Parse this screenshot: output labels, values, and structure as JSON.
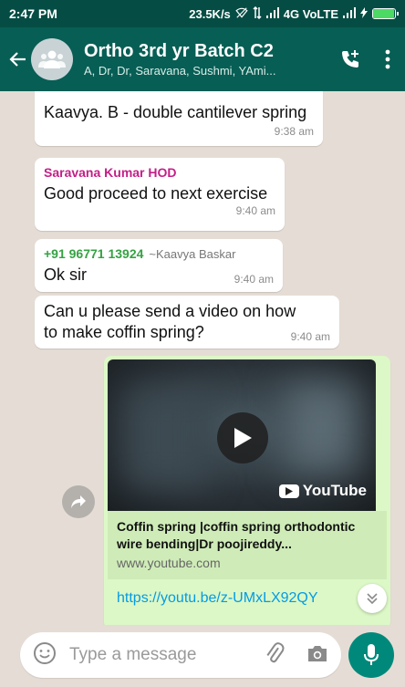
{
  "status_bar": {
    "time": "2:47 PM",
    "net_speed": "23.5K/s",
    "network": "4G VoLTE",
    "battery_level": 0.95
  },
  "header": {
    "title": "Ortho 3rd yr Batch C2",
    "subtitle": "A, Dr, Dr, Saravana, Sushmi, YAmi..."
  },
  "messages": [
    {
      "text": "Kaavya. B - double cantilever spring",
      "time": "9:38 am"
    },
    {
      "sender": "Saravana Kumar HOD",
      "sender_color": "#c41e88",
      "text": "Good proceed to next exercise",
      "time": "9:40 am"
    },
    {
      "sender": "+91 96771 13924",
      "sender_alias": "~Kaavya Baskar",
      "sender_color": "#35a243",
      "text": "Ok sir",
      "time": "9:40 am"
    },
    {
      "text": "Can u please send a video on how to make coffin spring?",
      "time": "9:40 am"
    }
  ],
  "link_preview": {
    "brand": "YouTube",
    "title": "Coffin spring |coffin spring orthodontic wire bending|Dr poojireddy...",
    "domain": "www.youtube.com",
    "url": "https://youtu.be/z-UMxLX92QY"
  },
  "input": {
    "placeholder": "Type a message"
  },
  "colors": {
    "header": "#075e54",
    "status_bar": "#054d44",
    "outgoing_bubble": "#dcf8c6",
    "chat_bg": "#e5ddd5",
    "accent": "#00897b",
    "link": "#039be5"
  }
}
